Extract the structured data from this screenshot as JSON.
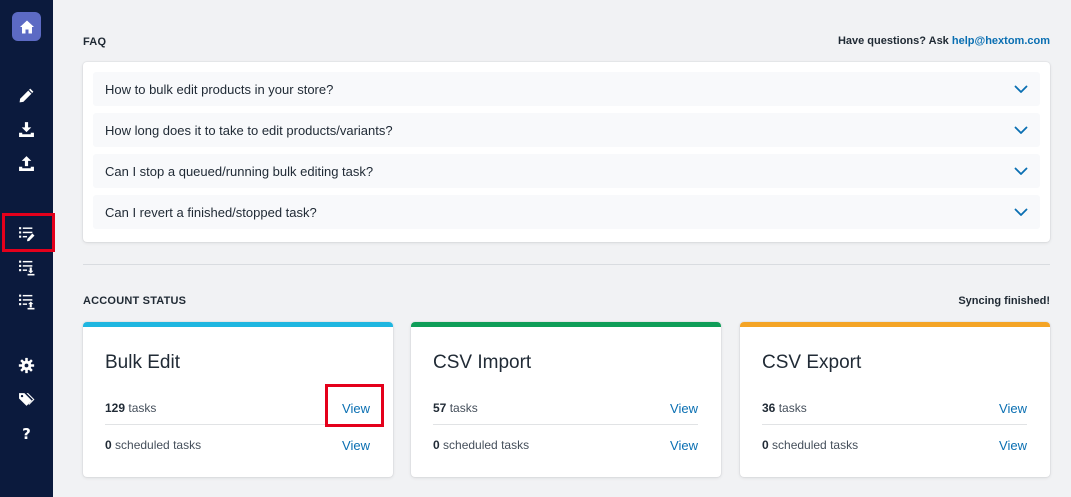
{
  "sidebar": {
    "items": [
      {
        "name": "home-icon"
      },
      {
        "name": "pencil-icon"
      },
      {
        "name": "download-icon"
      },
      {
        "name": "upload-icon"
      },
      {
        "name": "list-edit-icon"
      },
      {
        "name": "list-import-icon"
      },
      {
        "name": "list-export-icon"
      },
      {
        "name": "gear-icon"
      },
      {
        "name": "tags-icon"
      },
      {
        "name": "help-icon",
        "label": "?"
      }
    ],
    "highlighted_item": "list-edit-icon"
  },
  "faq": {
    "title": "FAQ",
    "contact_prefix": "Have questions? Ask ",
    "contact_email": "help@hextom.com",
    "questions": [
      "How to bulk edit products in your store?",
      "How long does it to take to edit products/variants?",
      "Can I stop a queued/running bulk editing task?",
      "Can I revert a finished/stopped task?"
    ]
  },
  "account_status": {
    "title": "ACCOUNT STATUS",
    "sync_status": "Syncing finished!",
    "cards": [
      {
        "title": "Bulk Edit",
        "tasks_count": "129",
        "tasks_label": " tasks",
        "scheduled_count": "0",
        "scheduled_label": " scheduled tasks",
        "view_label": "View",
        "accent": "#1fb6e0",
        "highlighted_view": true
      },
      {
        "title": "CSV Import",
        "tasks_count": "57",
        "tasks_label": " tasks",
        "scheduled_count": "0",
        "scheduled_label": " scheduled tasks",
        "view_label": "View",
        "accent": "#0f9d58",
        "highlighted_view": false
      },
      {
        "title": "CSV Export",
        "tasks_count": "36",
        "tasks_label": " tasks",
        "scheduled_count": "0",
        "scheduled_label": " scheduled tasks",
        "view_label": "View",
        "accent": "#f4a425",
        "highlighted_view": false
      }
    ]
  },
  "colors": {
    "sidebar_bg": "#0b1a3d",
    "home_bg": "#5c6ac4",
    "link": "#0a6fb2",
    "highlight": "#e4001b",
    "page_bg": "#f1f2f4"
  }
}
